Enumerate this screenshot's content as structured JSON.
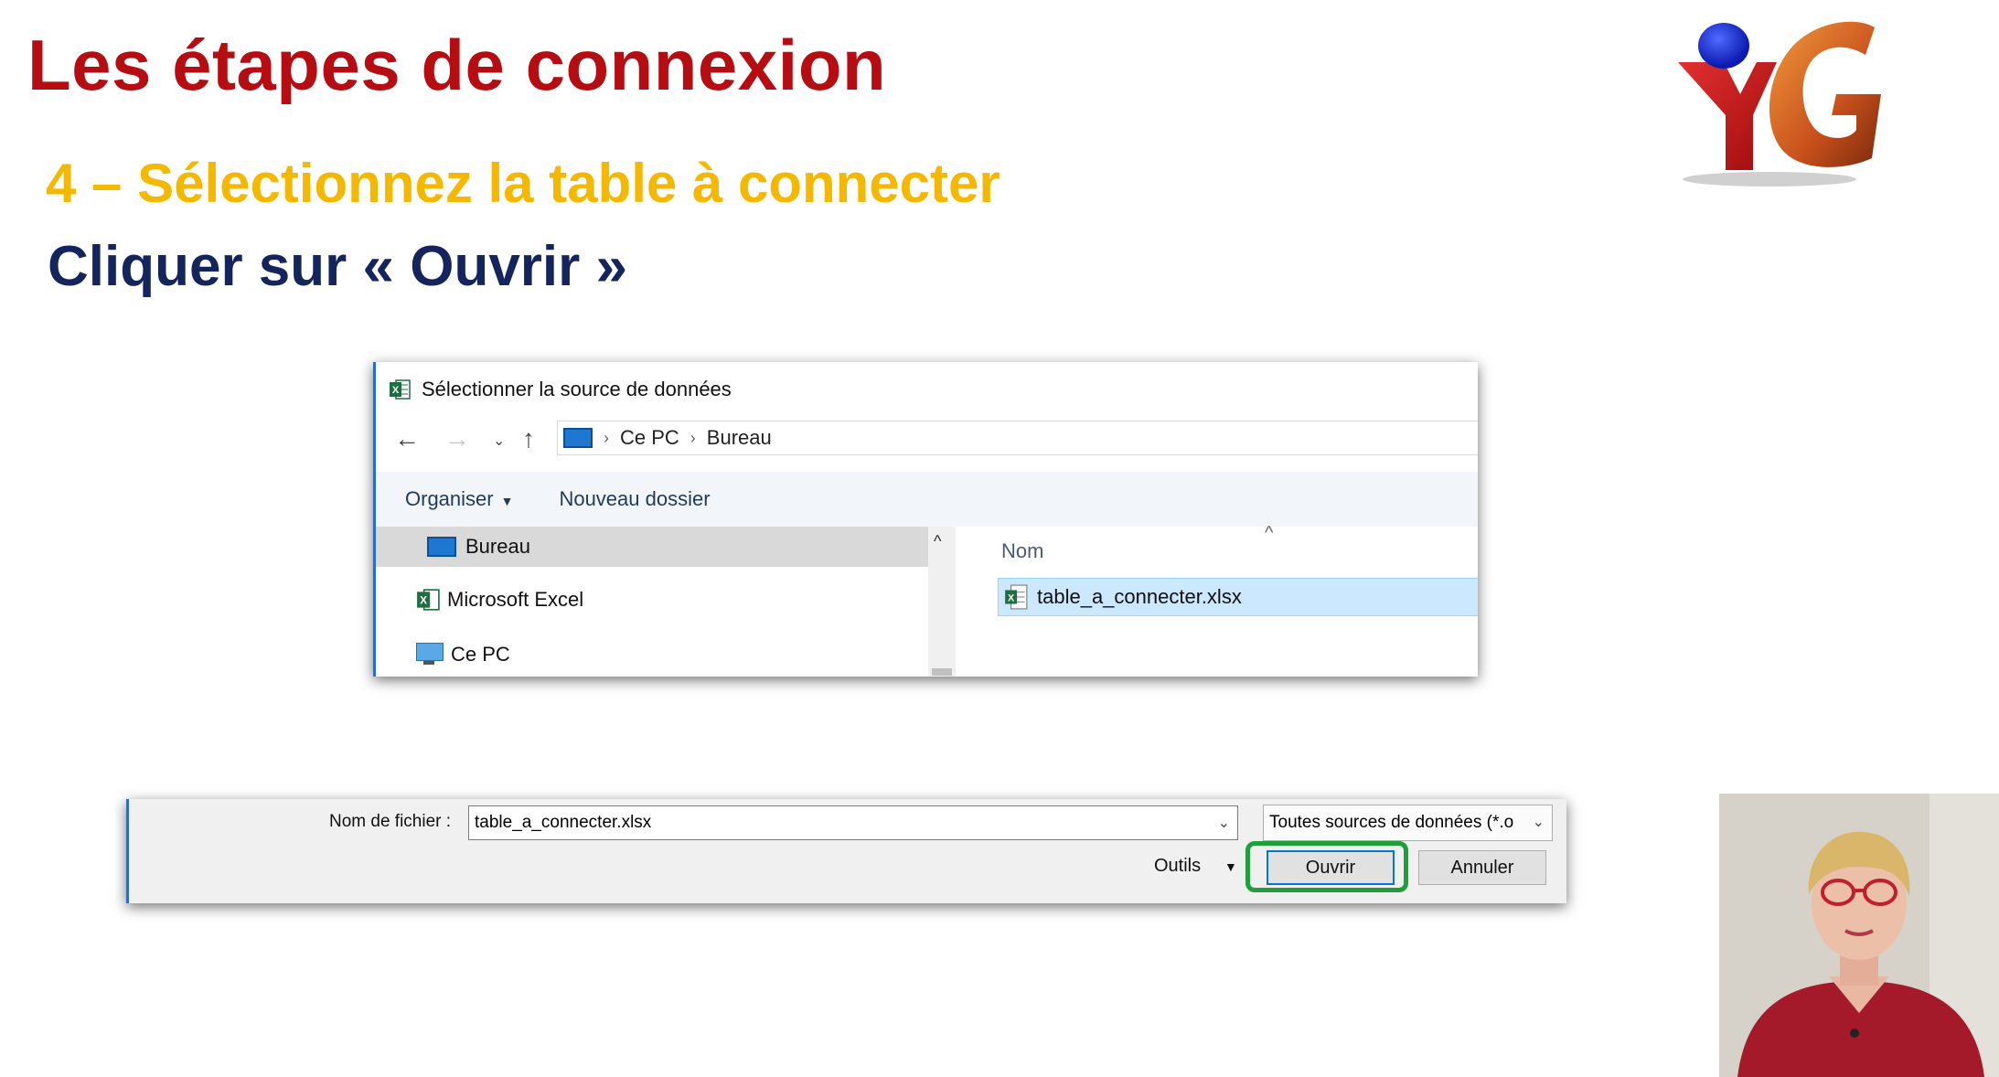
{
  "slide": {
    "title": "Les étapes de connexion",
    "subtitle": "4 – Sélectionnez la table à connecter",
    "instruction": "Cliquer sur « Ouvrir »"
  },
  "dialog_select": {
    "title": "Sélectionner la source de données",
    "breadcrumb": [
      "Ce PC",
      "Bureau"
    ],
    "toolbar": {
      "organize": "Organiser",
      "new_folder": "Nouveau dossier"
    },
    "nav_tree": [
      {
        "label": "Bureau",
        "icon": "desktop-icon",
        "selected": true
      },
      {
        "label": "Microsoft Excel",
        "icon": "excel-icon",
        "selected": false
      },
      {
        "label": "Ce PC",
        "icon": "computer-icon",
        "selected": false
      }
    ],
    "column_header": "Nom",
    "files": [
      {
        "name": "table_a_connecter.xlsx",
        "icon": "excel-file-icon",
        "selected": true
      }
    ]
  },
  "dialog_open": {
    "filename_label": "Nom de fichier :",
    "filename_value": "table_a_connecter.xlsx",
    "filetype_value": "Toutes sources de données (*.o",
    "tools_label": "Outils",
    "open_label": "Ouvrir",
    "cancel_label": "Annuler"
  },
  "colors": {
    "title": "#b50d12",
    "subtitle": "#f5b800",
    "instruction": "#14255e",
    "highlight": "#1e9f3a",
    "selection": "#cce8ff"
  }
}
